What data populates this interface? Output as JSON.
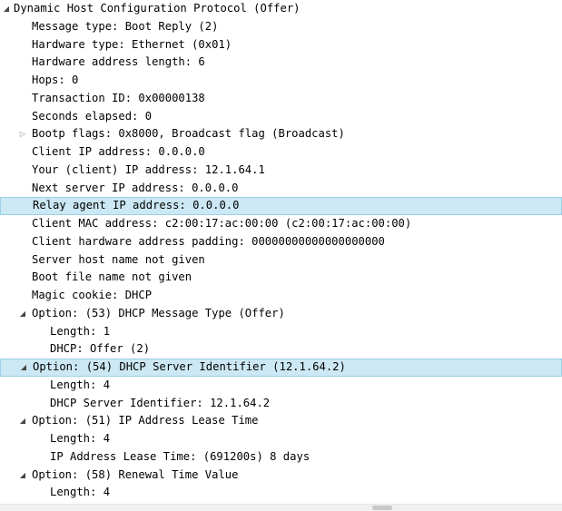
{
  "tree": {
    "root": "Dynamic Host Configuration Protocol (Offer)",
    "message_type": "Message type: Boot Reply (2)",
    "hardware_type": "Hardware type: Ethernet (0x01)",
    "hardware_address_length": "Hardware address length: 6",
    "hops": "Hops: 0",
    "transaction_id": "Transaction ID: 0x00000138",
    "seconds_elapsed": "Seconds elapsed: 0",
    "bootp_flags": "Bootp flags: 0x8000, Broadcast flag (Broadcast)",
    "client_ip": "Client IP address: 0.0.0.0",
    "your_ip": "Your (client) IP address: 12.1.64.1",
    "next_server_ip": "Next server IP address: 0.0.0.0",
    "relay_agent_ip": "Relay agent IP address: 0.0.0.0",
    "client_mac": "Client MAC address: c2:00:17:ac:00:00 (c2:00:17:ac:00:00)",
    "client_hw_padding": "Client hardware address padding: 00000000000000000000",
    "server_host_name": "Server host name not given",
    "boot_file_name": "Boot file name not given",
    "magic_cookie": "Magic cookie: DHCP",
    "opt53": "Option: (53) DHCP Message Type (Offer)",
    "opt53_length": "Length: 1",
    "opt53_value": "DHCP: Offer (2)",
    "opt54": "Option: (54) DHCP Server Identifier (12.1.64.2)",
    "opt54_length": "Length: 4",
    "opt54_value": "DHCP Server Identifier: 12.1.64.2",
    "opt51": "Option: (51) IP Address Lease Time",
    "opt51_length": "Length: 4",
    "opt51_value": "IP Address Lease Time: (691200s) 8 days",
    "opt58": "Option: (58) Renewal Time Value",
    "opt58_length": "Length: 4"
  },
  "icons": {
    "expanded": "expanded-triangle-icon",
    "collapsed": "collapsed-triangle-icon"
  },
  "colors": {
    "selection_background": "#cce8f4",
    "selection_border": "#99d1ea"
  }
}
